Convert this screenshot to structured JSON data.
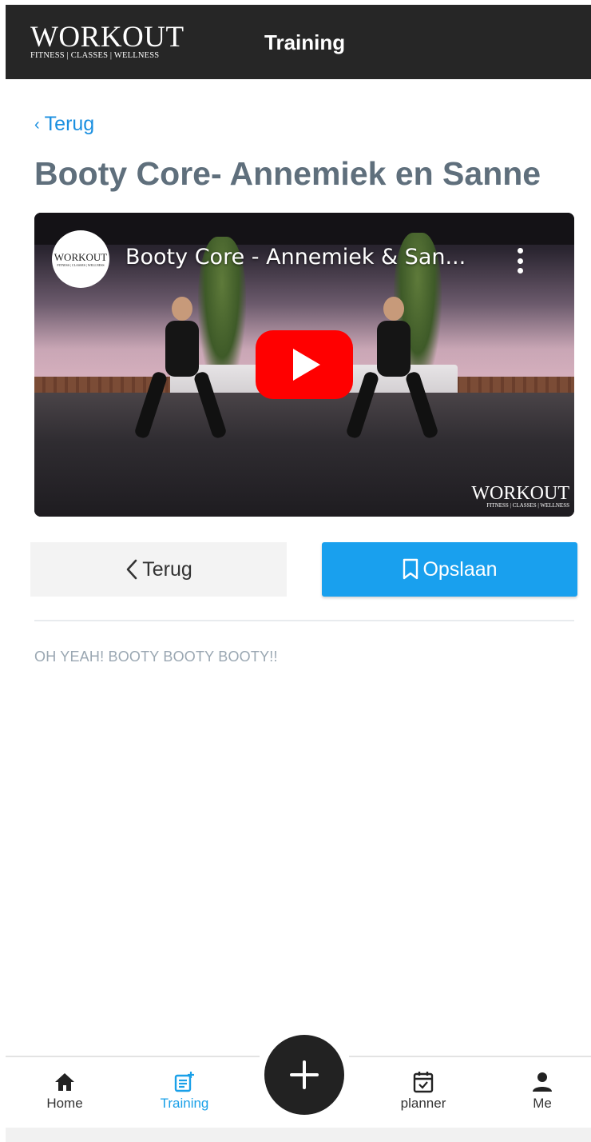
{
  "header": {
    "logo_word": "WORKOUT",
    "logo_sub": "FITNESS | CLASSES | WELLNESS",
    "title": "Training"
  },
  "back_link": {
    "label": "Terug"
  },
  "page_title": "Booty Core- Annemiek en Sanne",
  "video": {
    "channel_avatar_word": "WORKOUT",
    "channel_avatar_sub": "FITNESS | CLASSES | WELLNESS",
    "title": "Booty Core - Annemiek & San...",
    "watermark_word": "WORKOUT",
    "watermark_sub": "FITNESS | CLASSES | WELLNESS",
    "play_color": "#ff0000"
  },
  "actions": {
    "back_label": "Terug",
    "save_label": "Opslaan",
    "save_color": "#19a0ee"
  },
  "description": "OH YEAH! BOOTY BOOTY BOOTY!!",
  "tabbar": {
    "items": [
      {
        "label": "Home",
        "icon": "home-icon"
      },
      {
        "label": "Training",
        "icon": "training-icon",
        "active": true
      },
      {
        "label": "planner",
        "icon": "calendar-icon"
      },
      {
        "label": "Me",
        "icon": "person-icon"
      }
    ],
    "fab_icon": "plus-icon",
    "active_color": "#1aa0e8"
  }
}
